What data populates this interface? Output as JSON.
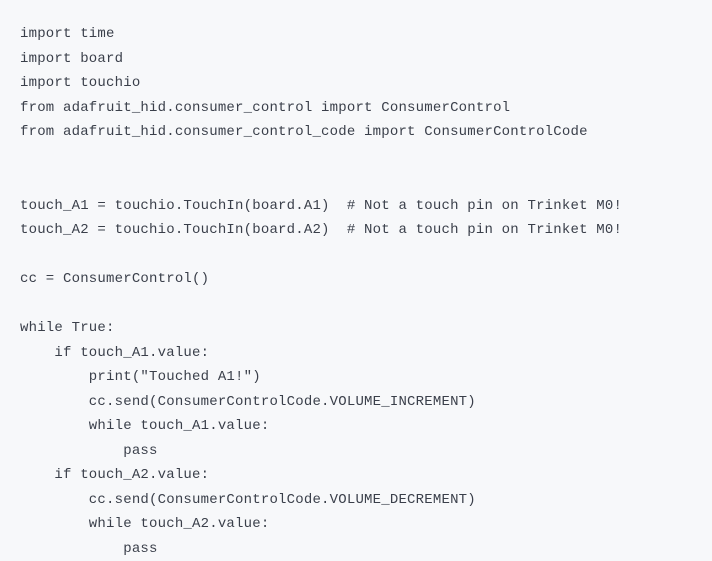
{
  "code": {
    "lines": [
      "import time",
      "import board",
      "import touchio",
      "from adafruit_hid.consumer_control import ConsumerControl",
      "from adafruit_hid.consumer_control_code import ConsumerControlCode",
      "",
      "",
      "touch_A1 = touchio.TouchIn(board.A1)  # Not a touch pin on Trinket M0!",
      "touch_A2 = touchio.TouchIn(board.A2)  # Not a touch pin on Trinket M0!",
      "",
      "cc = ConsumerControl()",
      "",
      "while True:",
      "    if touch_A1.value:",
      "        print(\"Touched A1!\")",
      "        cc.send(ConsumerControlCode.VOLUME_INCREMENT)",
      "        while touch_A1.value:",
      "            pass",
      "    if touch_A2.value:",
      "        cc.send(ConsumerControlCode.VOLUME_DECREMENT)",
      "        while touch_A2.value:",
      "            pass"
    ]
  }
}
